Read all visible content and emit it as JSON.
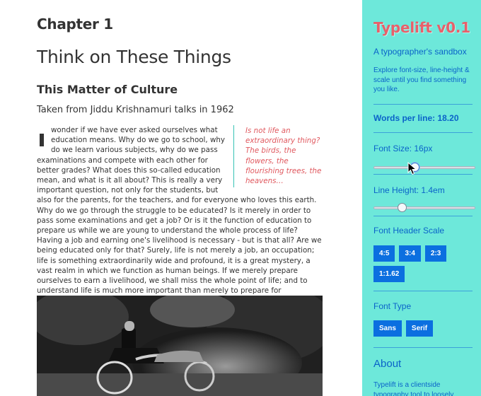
{
  "article": {
    "chapter": "Chapter 1",
    "title": "Think on These Things",
    "subtitle": "This Matter of Culture",
    "source": "Taken from Jiddu Krishnamuri talks in 1962",
    "pullquote": "Is not life an extraordinary thing? The birds, the flowers, the flourishing trees, the heavens…",
    "body": "wonder if we have ever asked ourselves what education means. Why do we go to school, why do we learn various subjects, why do we pass examinations and compete with each other for better grades? What does this so-called education mean, and what is it all about? This is really a very important question, not only for the students, but also for the parents, for the teachers, and for everyone who loves this earth. Why do we go through the struggle to be educated? Is it merely in order to pass some examinations and get a job? Or is it the function of education to prepare us while we are young to understand the whole process of life? Having a job and earning one's livelihood is necessary - but is that all? Are we being educated only for that? Surely, life is not merely a job, an occupation; life is something extraordinarily wide and profound, it is a great mystery, a vast realm in which we function as human beings. If we merely prepare ourselves to earn a livelihood, we shall miss the whole point of life; and to understand life is much more important than merely to prepare for examinations and become very proficient in mathematics, physics, or what you will."
  },
  "sidebar": {
    "logo": "Typelift v0.1",
    "tagline": "A typographer's sandbox",
    "intro": "Explore font-size, line-height & scale until you find something you like.",
    "words_per_line": "Words per line: 18.20",
    "font_size_label": "Font Size: 16px",
    "font_size_value": 0.4,
    "line_height_label": "Line Height: 1.4em",
    "line_height_value": 0.26,
    "header_scale_label": "Font Header Scale",
    "scale_buttons": [
      "4:5",
      "3:4",
      "2:3",
      "1:1.62"
    ],
    "font_type_label": "Font Type",
    "font_buttons": [
      "Sans",
      "Serif"
    ],
    "about_heading": "About",
    "about_text": "Typelift is a clientside typography tool to loosely"
  },
  "colors": {
    "sidebar_bg": "#6de8da",
    "accent_blue": "#0b6fe0",
    "logo_red": "#e8606a",
    "pullquote_red": "#e0595f"
  }
}
